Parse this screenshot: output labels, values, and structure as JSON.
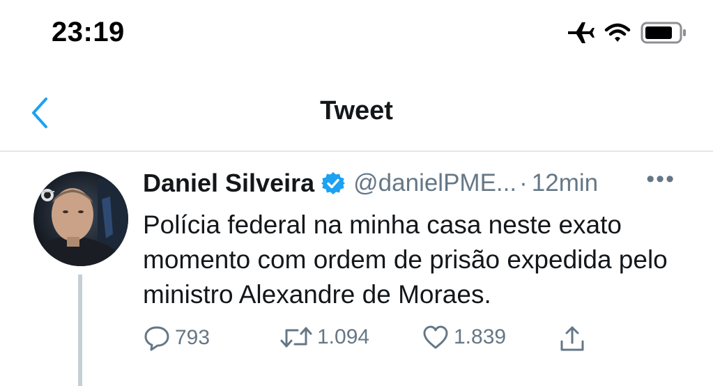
{
  "status_bar": {
    "time": "23:19",
    "icons": [
      "airplane-icon",
      "wifi-icon",
      "battery-icon"
    ]
  },
  "nav": {
    "back_icon": "chevron-left-icon",
    "title": "Tweet"
  },
  "tweet": {
    "author_name": "Daniel Silveira",
    "verified": true,
    "handle": "@danielPME...",
    "separator": "·",
    "time_ago": "12min",
    "more": "•••",
    "text": "Polícia federal na minha casa neste exato momento com ordem de prisão expedida pelo ministro Alexandre de Moraes.",
    "actions": {
      "reply_count": "793",
      "retweet_count": "1.094",
      "like_count": "1.839"
    }
  },
  "colors": {
    "accent": "#1da1f2",
    "secondary_text": "#657786",
    "divider": "#e1e8ed",
    "thread_line": "#c4cfd6"
  }
}
